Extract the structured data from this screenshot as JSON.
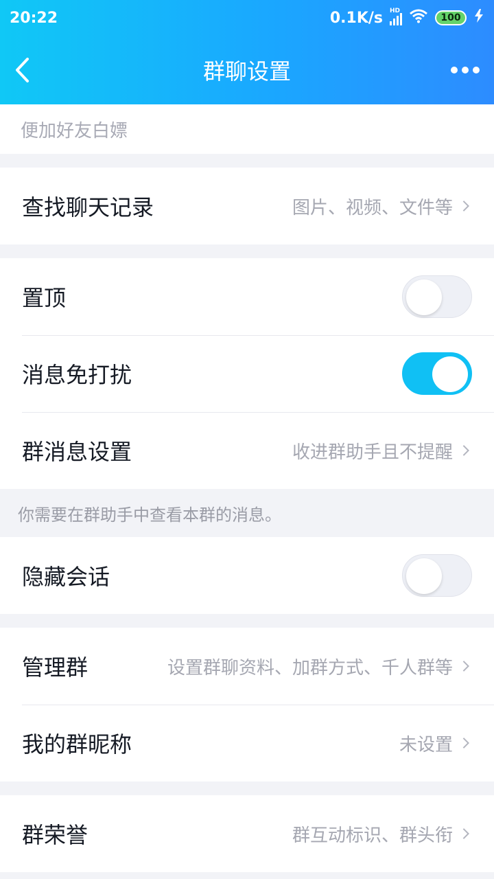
{
  "status": {
    "time": "20:22",
    "network_speed": "0.1K/s",
    "network_type": "HD",
    "battery": "100"
  },
  "header": {
    "title": "群聊设置"
  },
  "intro_hint": "便加好友白嫖",
  "search": {
    "label": "查找聊天记录",
    "value": "图片、视频、文件等"
  },
  "settings": {
    "pin": {
      "label": "置顶",
      "on": false
    },
    "mute": {
      "label": "消息免打扰",
      "on": true
    },
    "group_message": {
      "label": "群消息设置",
      "value": "收进群助手且不提醒"
    }
  },
  "assistant_hint": "你需要在群助手中查看本群的消息。",
  "hide_chat": {
    "label": "隐藏会话",
    "on": false
  },
  "manage": {
    "label": "管理群",
    "value": "设置群聊资料、加群方式、千人群等"
  },
  "nickname": {
    "label": "我的群昵称",
    "value": "未设置"
  },
  "honor": {
    "label": "群荣誉",
    "value": "群互动标识、群头衔"
  },
  "colors": {
    "accent": "#10c0f4",
    "header_start": "#10c8f6",
    "header_end": "#2d8cff"
  }
}
